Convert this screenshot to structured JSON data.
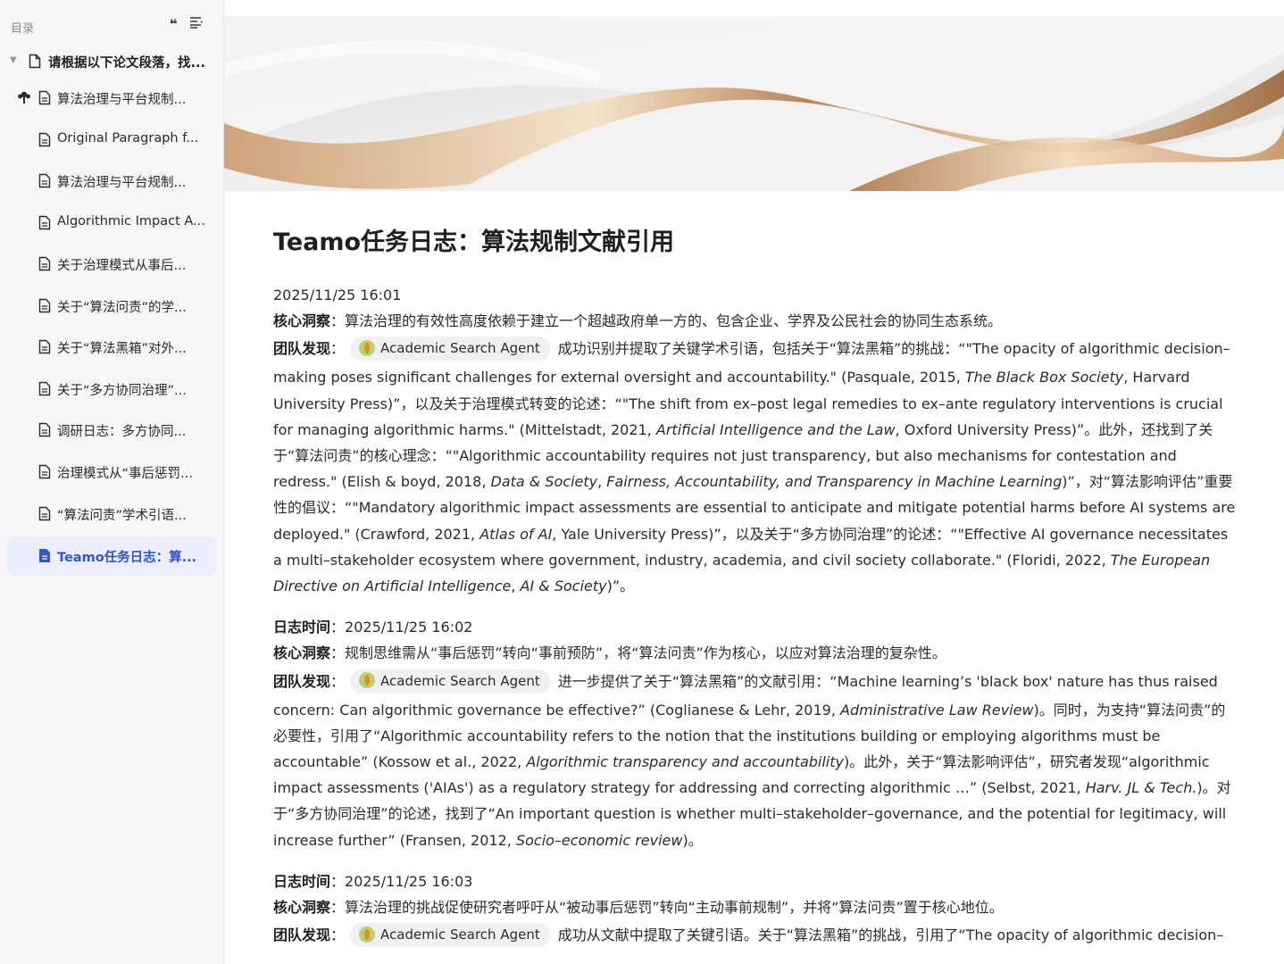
{
  "sidebar": {
    "title": "目录",
    "root": {
      "label": "请根据以下论文段落，找..."
    },
    "items": [
      {
        "label": "算法治理与平台规制..."
      },
      {
        "label": "Original Paragraph f..."
      },
      {
        "label": "算法治理与平台规制..."
      },
      {
        "label": "Algorithmic Impact A..."
      },
      {
        "label": "关于治理模式从事后..."
      },
      {
        "label": "关于“算法问责”的学..."
      },
      {
        "label": "关于“算法黑箱”对外..."
      },
      {
        "label": "关于“多方协同治理”..."
      },
      {
        "label": "调研日志：多方协同..."
      },
      {
        "label": "治理模式从“事后惩罚..."
      },
      {
        "label": "“算法问责”学术引语..."
      },
      {
        "label": "Teamo任务日志：算..."
      }
    ]
  },
  "main": {
    "title": "Teamo任务日志：算法规制文献引用",
    "agent_name": "Academic Search Agent",
    "labels": {
      "log_time": "日志时间",
      "insight": "核心洞察",
      "team_finding": "团队发现",
      "colon": "："
    },
    "entries": [
      {
        "time": "2025/11/25 16:01",
        "insight": "算法治理的有效性高度依赖于建立一个超越政府单一方的、包含企业、学界及公民社会的协同生态系统。",
        "finding_lead": "成功识别并提取了关键学术引语，包括关于“算法黑箱”的挑战：“\"The opacity of algorithmic decision–",
        "finding_rest": [
          "making poses significant challenges for external oversight and accountability.\" (Pasquale, 2015, ",
          "The Black Box Society",
          ", Harvard University Press)”，以及关于治理模式转变的论述：“\"The shift from ex–post legal remedies to ex–ante regulatory interventions is crucial for managing algorithmic harms.\" (Mittelstadt, 2021, ",
          "Artificial Intelligence and the Law",
          ", Oxford University Press)”。此外，还找到了关于“算法问责”的核心理念：“\"Algorithmic accountability requires not just transparency, but also mechanisms for contestation and redress.\" (Elish & boyd, 2018, ",
          "Data & Society",
          ", ",
          "Fairness, Accountability, and Transparency in Machine Learning",
          ")”，对“算法影响评估”重要性的倡议：“\"Mandatory algorithmic impact assessments are essential to anticipate and mitigate potential harms before AI systems are deployed.\" (Crawford, 2021, ",
          "Atlas of AI",
          ", Yale University Press)”，以及关于“多方协同治理”的论述：“\"Effective AI governance necessitates a multi–stakeholder ecosystem where government, industry, academia, and civil society collaborate.\" (Floridi, 2022, ",
          "The European Directive on Artificial Intelligence",
          ", ",
          "AI & Society",
          ")”。"
        ]
      },
      {
        "time": "2025/11/25 16:02",
        "insight": "规制思维需从“事后惩罚”转向“事前预防”，将“算法问责”作为核心，以应对算法治理的复杂性。",
        "finding_lead": "进一步提供了关于“算法黑箱”的文献引用：“Machine learning’s 'black box' nature has thus raised",
        "finding_rest": [
          "concern: Can algorithmic governance be effective?” (Coglianese & Lehr, 2019, ",
          "Administrative Law Review",
          ")。同时，为支持“算法问责”的必要性，引用了“Algorithmic accountability refers to the notion that the institutions building or employing algorithms must be accountable” (Kossow et al., 2022, ",
          "Algorithmic transparency and accountability",
          ")。此外，关于“算法影响评估”，研究者发现“algorithmic impact assessments ('AIAs') as a regulatory strategy for addressing and correcting algorithmic …” (Selbst, 2021, ",
          "Harv. JL & Tech.",
          ")。对于“多方协同治理”的论述，找到了“An important question is whether multi–stakeholder–governance, and the potential for legitimacy, will increase further” (Fransen, 2012, ",
          "Socio–economic review",
          ")。"
        ]
      },
      {
        "time": "2025/11/25 16:03",
        "insight": "算法治理的挑战促使研究者呼吁从“被动事后惩罚”转向“主动事前规制”，并将“算法问责”置于核心地位。",
        "finding_lead": "成功从文献中提取了关键引语。关于“算法黑箱”的挑战，引用了“The opacity of algorithmic decision–",
        "finding_rest": []
      }
    ]
  }
}
